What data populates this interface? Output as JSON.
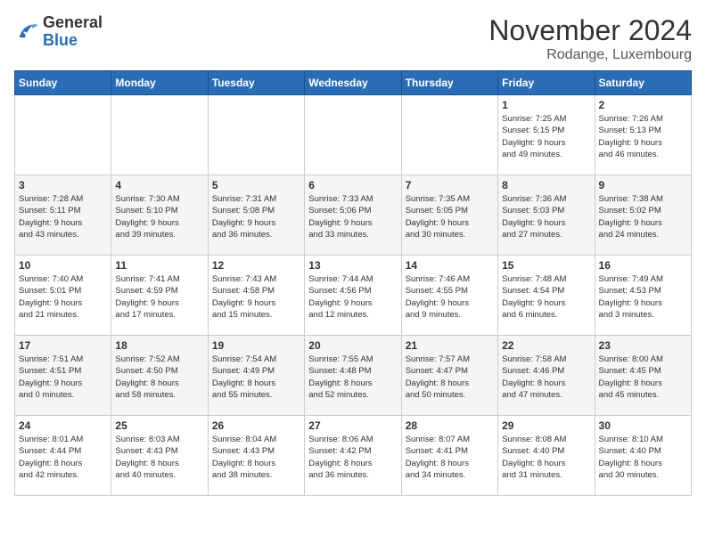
{
  "header": {
    "logo_general": "General",
    "logo_blue": "Blue",
    "month_title": "November 2024",
    "subtitle": "Rodange, Luxembourg"
  },
  "weekdays": [
    "Sunday",
    "Monday",
    "Tuesday",
    "Wednesday",
    "Thursday",
    "Friday",
    "Saturday"
  ],
  "weeks": [
    [
      {
        "day": "",
        "info": ""
      },
      {
        "day": "",
        "info": ""
      },
      {
        "day": "",
        "info": ""
      },
      {
        "day": "",
        "info": ""
      },
      {
        "day": "",
        "info": ""
      },
      {
        "day": "1",
        "info": "Sunrise: 7:25 AM\nSunset: 5:15 PM\nDaylight: 9 hours\nand 49 minutes."
      },
      {
        "day": "2",
        "info": "Sunrise: 7:26 AM\nSunset: 5:13 PM\nDaylight: 9 hours\nand 46 minutes."
      }
    ],
    [
      {
        "day": "3",
        "info": "Sunrise: 7:28 AM\nSunset: 5:11 PM\nDaylight: 9 hours\nand 43 minutes."
      },
      {
        "day": "4",
        "info": "Sunrise: 7:30 AM\nSunset: 5:10 PM\nDaylight: 9 hours\nand 39 minutes."
      },
      {
        "day": "5",
        "info": "Sunrise: 7:31 AM\nSunset: 5:08 PM\nDaylight: 9 hours\nand 36 minutes."
      },
      {
        "day": "6",
        "info": "Sunrise: 7:33 AM\nSunset: 5:06 PM\nDaylight: 9 hours\nand 33 minutes."
      },
      {
        "day": "7",
        "info": "Sunrise: 7:35 AM\nSunset: 5:05 PM\nDaylight: 9 hours\nand 30 minutes."
      },
      {
        "day": "8",
        "info": "Sunrise: 7:36 AM\nSunset: 5:03 PM\nDaylight: 9 hours\nand 27 minutes."
      },
      {
        "day": "9",
        "info": "Sunrise: 7:38 AM\nSunset: 5:02 PM\nDaylight: 9 hours\nand 24 minutes."
      }
    ],
    [
      {
        "day": "10",
        "info": "Sunrise: 7:40 AM\nSunset: 5:01 PM\nDaylight: 9 hours\nand 21 minutes."
      },
      {
        "day": "11",
        "info": "Sunrise: 7:41 AM\nSunset: 4:59 PM\nDaylight: 9 hours\nand 17 minutes."
      },
      {
        "day": "12",
        "info": "Sunrise: 7:43 AM\nSunset: 4:58 PM\nDaylight: 9 hours\nand 15 minutes."
      },
      {
        "day": "13",
        "info": "Sunrise: 7:44 AM\nSunset: 4:56 PM\nDaylight: 9 hours\nand 12 minutes."
      },
      {
        "day": "14",
        "info": "Sunrise: 7:46 AM\nSunset: 4:55 PM\nDaylight: 9 hours\nand 9 minutes."
      },
      {
        "day": "15",
        "info": "Sunrise: 7:48 AM\nSunset: 4:54 PM\nDaylight: 9 hours\nand 6 minutes."
      },
      {
        "day": "16",
        "info": "Sunrise: 7:49 AM\nSunset: 4:53 PM\nDaylight: 9 hours\nand 3 minutes."
      }
    ],
    [
      {
        "day": "17",
        "info": "Sunrise: 7:51 AM\nSunset: 4:51 PM\nDaylight: 9 hours\nand 0 minutes."
      },
      {
        "day": "18",
        "info": "Sunrise: 7:52 AM\nSunset: 4:50 PM\nDaylight: 8 hours\nand 58 minutes."
      },
      {
        "day": "19",
        "info": "Sunrise: 7:54 AM\nSunset: 4:49 PM\nDaylight: 8 hours\nand 55 minutes."
      },
      {
        "day": "20",
        "info": "Sunrise: 7:55 AM\nSunset: 4:48 PM\nDaylight: 8 hours\nand 52 minutes."
      },
      {
        "day": "21",
        "info": "Sunrise: 7:57 AM\nSunset: 4:47 PM\nDaylight: 8 hours\nand 50 minutes."
      },
      {
        "day": "22",
        "info": "Sunrise: 7:58 AM\nSunset: 4:46 PM\nDaylight: 8 hours\nand 47 minutes."
      },
      {
        "day": "23",
        "info": "Sunrise: 8:00 AM\nSunset: 4:45 PM\nDaylight: 8 hours\nand 45 minutes."
      }
    ],
    [
      {
        "day": "24",
        "info": "Sunrise: 8:01 AM\nSunset: 4:44 PM\nDaylight: 8 hours\nand 42 minutes."
      },
      {
        "day": "25",
        "info": "Sunrise: 8:03 AM\nSunset: 4:43 PM\nDaylight: 8 hours\nand 40 minutes."
      },
      {
        "day": "26",
        "info": "Sunrise: 8:04 AM\nSunset: 4:43 PM\nDaylight: 8 hours\nand 38 minutes."
      },
      {
        "day": "27",
        "info": "Sunrise: 8:06 AM\nSunset: 4:42 PM\nDaylight: 8 hours\nand 36 minutes."
      },
      {
        "day": "28",
        "info": "Sunrise: 8:07 AM\nSunset: 4:41 PM\nDaylight: 8 hours\nand 34 minutes."
      },
      {
        "day": "29",
        "info": "Sunrise: 8:08 AM\nSunset: 4:40 PM\nDaylight: 8 hours\nand 31 minutes."
      },
      {
        "day": "30",
        "info": "Sunrise: 8:10 AM\nSunset: 4:40 PM\nDaylight: 8 hours\nand 30 minutes."
      }
    ]
  ]
}
